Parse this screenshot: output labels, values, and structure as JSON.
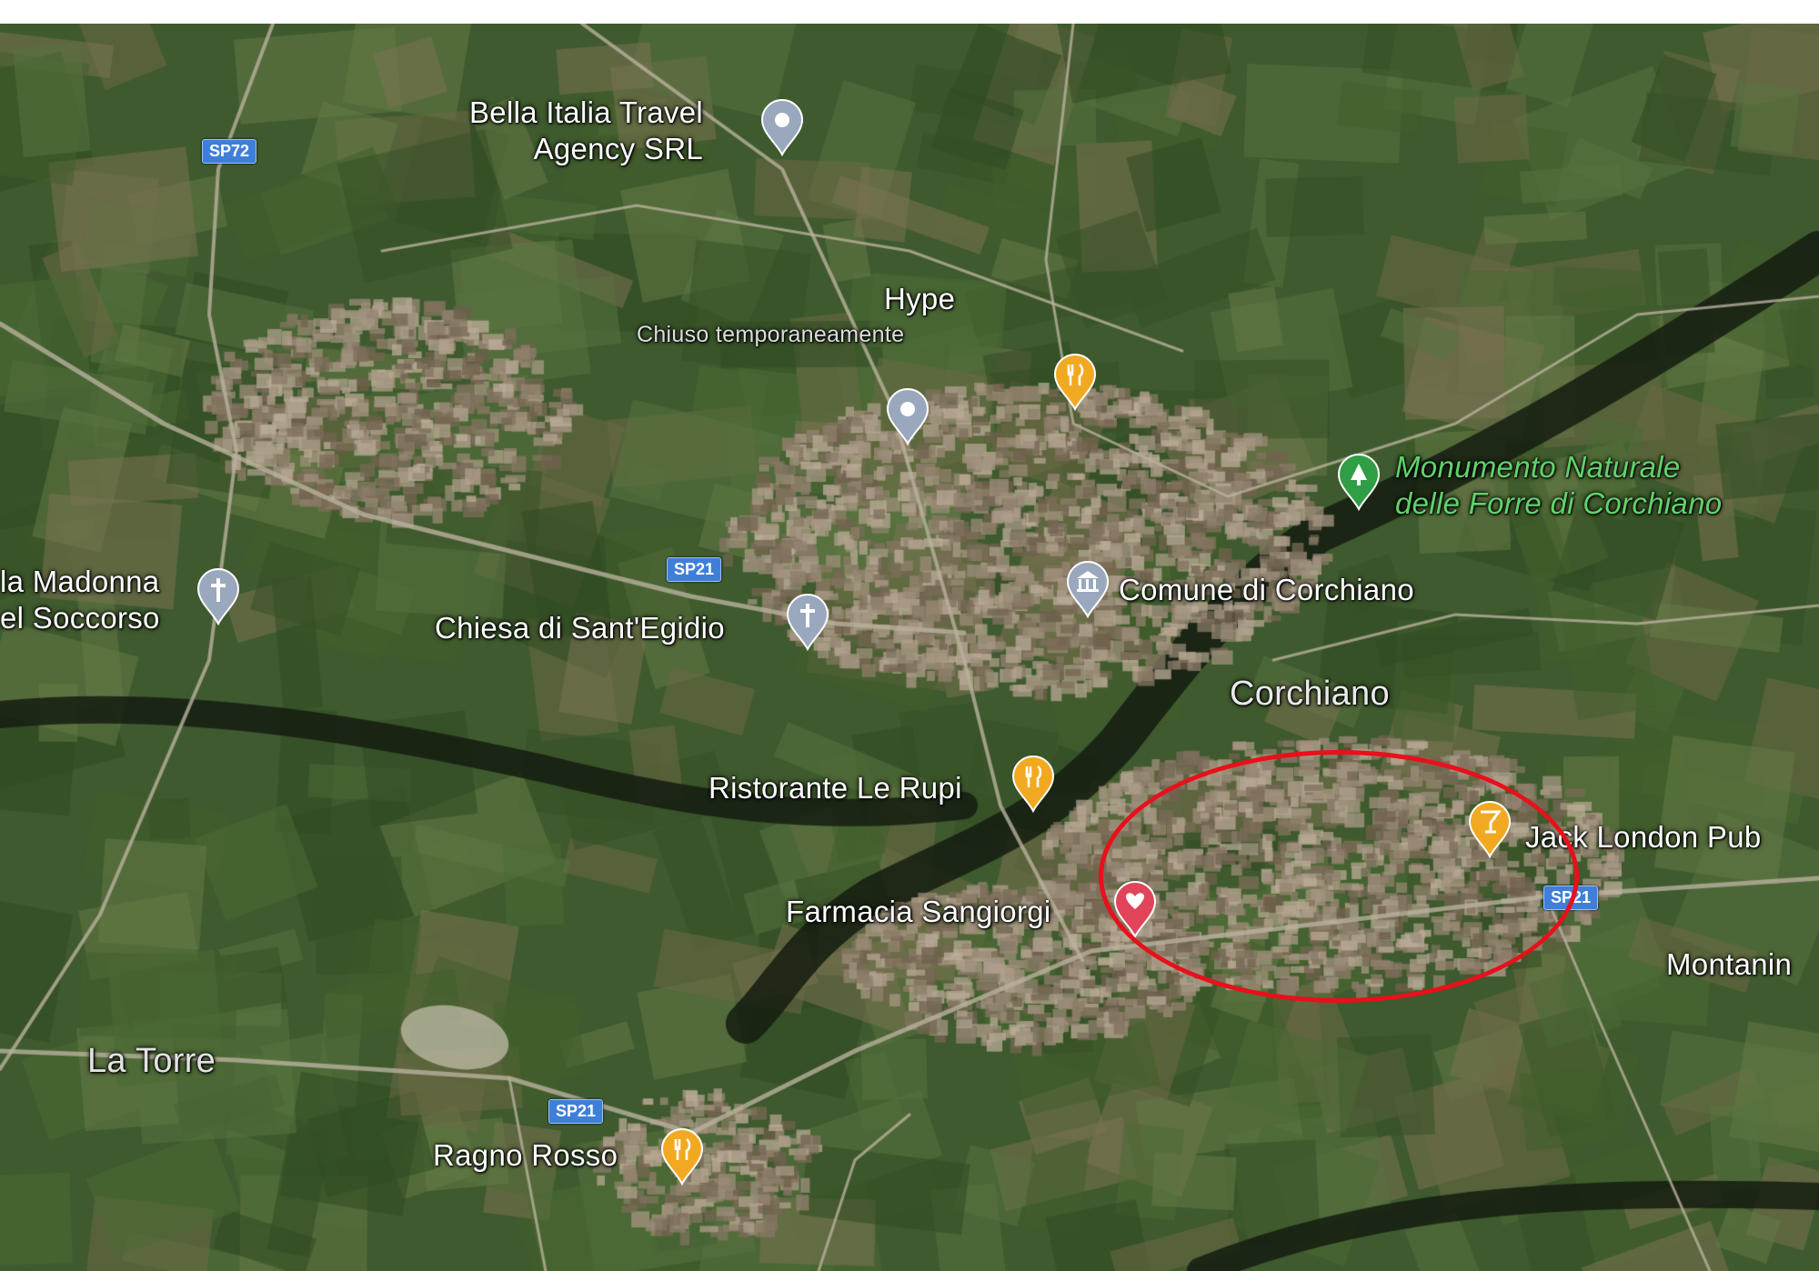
{
  "map": {
    "pois": {
      "bella_italia": "Bella Italia Travel\nAgency SRL",
      "hype": "Hype",
      "hype_status": "Chiuso temporaneamente",
      "monumento": "Monumento Naturale\ndelle Forre di Corchiano",
      "madonna": "la Madonna\nel Soccorso",
      "chiesa_egidio": "Chiesa di Sant'Egidio",
      "comune": "Comune di Corchiano",
      "ristorante": "Ristorante Le Rupi",
      "jack_london": "Jack London Pub",
      "farmacia": "Farmacia Sangiorgi",
      "ragno_rosso": "Ragno Rosso",
      "montanina": "Montanin"
    },
    "places": {
      "corchiano": "Corchiano",
      "la_torre": "La Torre"
    },
    "roads": {
      "sp72": "SP72",
      "sp21_center": "SP21",
      "sp21_east": "SP21",
      "sp21_south": "SP21"
    },
    "pin_icons": {
      "restaurant": "restaurant-icon",
      "bar": "bar-icon",
      "place": "place-pin-icon",
      "church": "church-icon",
      "government": "government-building-icon",
      "park": "park-icon",
      "pharmacy": "pharmacy-icon"
    },
    "colors": {
      "restaurant_pin": "#f2a922",
      "bar_pin": "#f2a922",
      "place_pin": "#9aa8bd",
      "park_pin": "#2f9e44",
      "pharmacy_pin": "#e0455a",
      "highlight_circle": "#e8101a",
      "road_shield": "#3f7fd9"
    }
  }
}
